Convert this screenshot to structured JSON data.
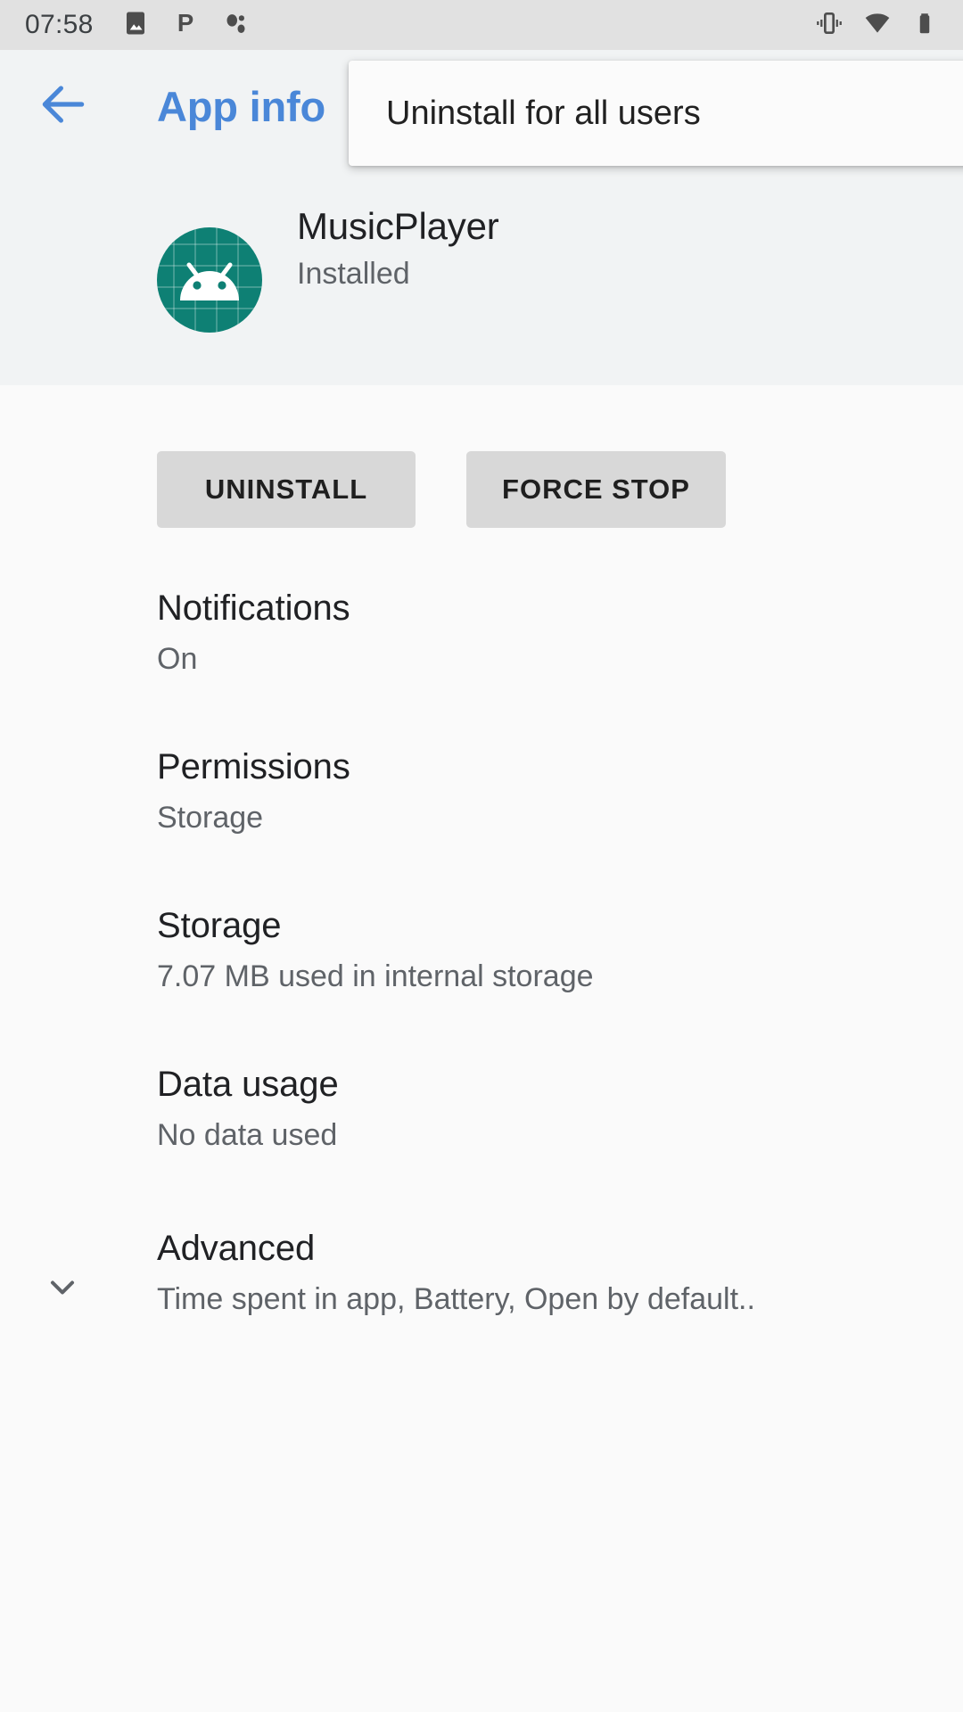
{
  "status_bar": {
    "time": "07:58",
    "left_icons": [
      "photo-icon",
      "p-letter-icon",
      "dots-icon"
    ],
    "right_icons": [
      "vibrate-icon",
      "wifi-icon",
      "battery-icon"
    ]
  },
  "app_bar": {
    "back_icon": "arrow-back-icon",
    "title": "App info",
    "title_color": "#4a87d8"
  },
  "popup_menu": {
    "items": [
      {
        "label": "Uninstall for all users"
      }
    ]
  },
  "app_header": {
    "icon_name": "musicplayer-app-icon",
    "icon_color": "#0e8074",
    "name": "MusicPlayer",
    "status": "Installed"
  },
  "actions": {
    "uninstall_label": "UNINSTALL",
    "force_stop_label": "FORCE STOP"
  },
  "preferences": [
    {
      "title": "Notifications",
      "summary": "On"
    },
    {
      "title": "Permissions",
      "summary": "Storage"
    },
    {
      "title": "Storage",
      "summary": "7.07 MB used in internal storage"
    },
    {
      "title": "Data usage",
      "summary": "No data used"
    },
    {
      "title": "Advanced",
      "summary": "Time spent in app, Battery, Open by default..",
      "icon": "chevron-down-icon"
    }
  ]
}
